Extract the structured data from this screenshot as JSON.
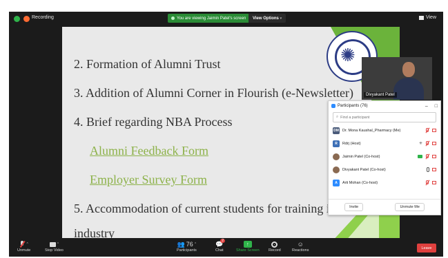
{
  "topbar": {
    "recording_label": "Recording",
    "viewing_label": "You are viewing Jaimin Patel's screen",
    "view_options_label": "View Options",
    "view_label": "View"
  },
  "slide": {
    "lines": [
      "2. Formation of Alumni Trust",
      "3. Addition of Alumni Corner in Flourish (e-Newsletter)",
      "4. Brief regarding NBA Process",
      "Alumni Feedback Form",
      "Employer Survey Form",
      "5. Accommodation of current students for training in",
      "industry"
    ]
  },
  "video": {
    "name": "Divyakant Patel"
  },
  "participants": {
    "title": "Participants (76)",
    "search_placeholder": "Find a participant",
    "rows": [
      {
        "initials": "DM",
        "name": "Dr. Mona Kaushal_Pharmacy (Me)"
      },
      {
        "initials": "R",
        "name": "Rdrj (Host)"
      },
      {
        "initials": "",
        "name": "Jaimin Patel (Co-host)"
      },
      {
        "initials": "",
        "name": "Divyakant Patel (Co-host)"
      },
      {
        "initials": "A",
        "name": "Arti Mohan (Co-host)"
      }
    ],
    "invite_label": "Invite",
    "unmute_me_label": "Unmute Me"
  },
  "toolbar": {
    "unmute_label": "Unmute",
    "stop_video_label": "Stop Video",
    "participants_count": "76",
    "participants_label": "Participants",
    "chat_label": "Chat",
    "chat_badge": "2",
    "share_screen_label": "Share Screen",
    "record_label": "Record",
    "reactions_label": "Reactions",
    "leave_label": "Leave"
  },
  "colors": {
    "accent_green": "#2fb34a",
    "leave_red": "#e0403e",
    "link_green": "#8db24a"
  }
}
